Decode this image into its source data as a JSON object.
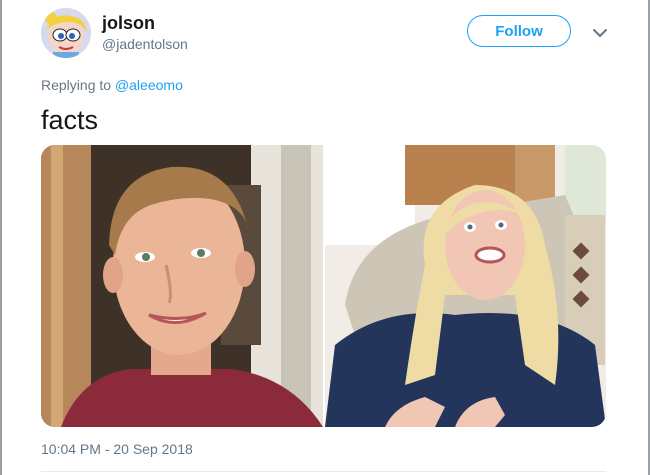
{
  "user": {
    "display_name": "jolson",
    "handle": "@jadentolson",
    "avatar_icon": "cartoon-avatar"
  },
  "actions": {
    "follow_label": "Follow",
    "menu_icon": "chevron-down-icon"
  },
  "reply": {
    "prefix": "Replying to ",
    "mention": "@aleeomo"
  },
  "tweet": {
    "text": "facts",
    "timestamp": "10:04 PM - 20 Sep 2018"
  },
  "media": {
    "images": [
      {
        "name": "photo-smiling-young-man"
      },
      {
        "name": "photo-grimacing-woman-blonde"
      }
    ]
  },
  "colors": {
    "accent": "#1da1f2",
    "muted": "#657786",
    "text": "#14171a"
  }
}
